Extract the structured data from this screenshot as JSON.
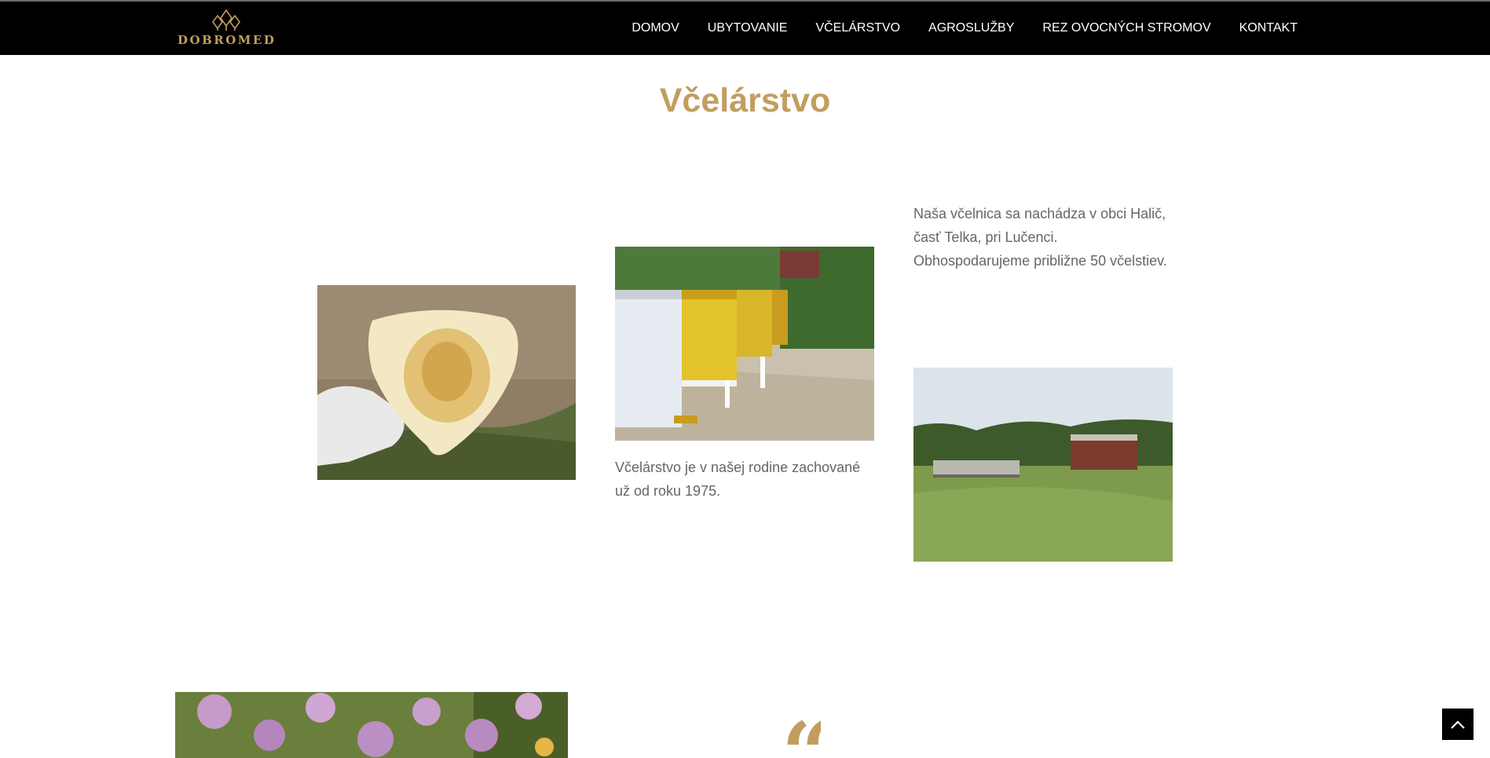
{
  "brand": {
    "name": "DOBROMED",
    "color": "#c19e5f"
  },
  "nav": {
    "items": [
      {
        "label": "DOMOV"
      },
      {
        "label": "UBYTOVANIE"
      },
      {
        "label": "VČELÁRSTVO"
      },
      {
        "label": "AGROSLUŽBY"
      },
      {
        "label": "REZ OVOCNÝCH STROMOV"
      },
      {
        "label": "KONTAKT"
      }
    ]
  },
  "page": {
    "title": "Včelárstvo",
    "intro": {
      "lines": [
        "Naša včelnica sa nachádza v obci Halič,",
        "časť Telka, pri Lučenci.",
        "Obhospodarujeme približne 50 včelstiev."
      ]
    },
    "history": {
      "lines": [
        "Včelárstvo je v našej rodine zachované",
        "už od roku  1975."
      ]
    },
    "quote_mark": "“"
  },
  "icons": {
    "logo": "tree-crown-logo-icon",
    "back_to_top": "chevron-up-icon"
  },
  "colors": {
    "accent": "#c19e5f",
    "navbar": "#000000",
    "body_text": "#666666"
  }
}
